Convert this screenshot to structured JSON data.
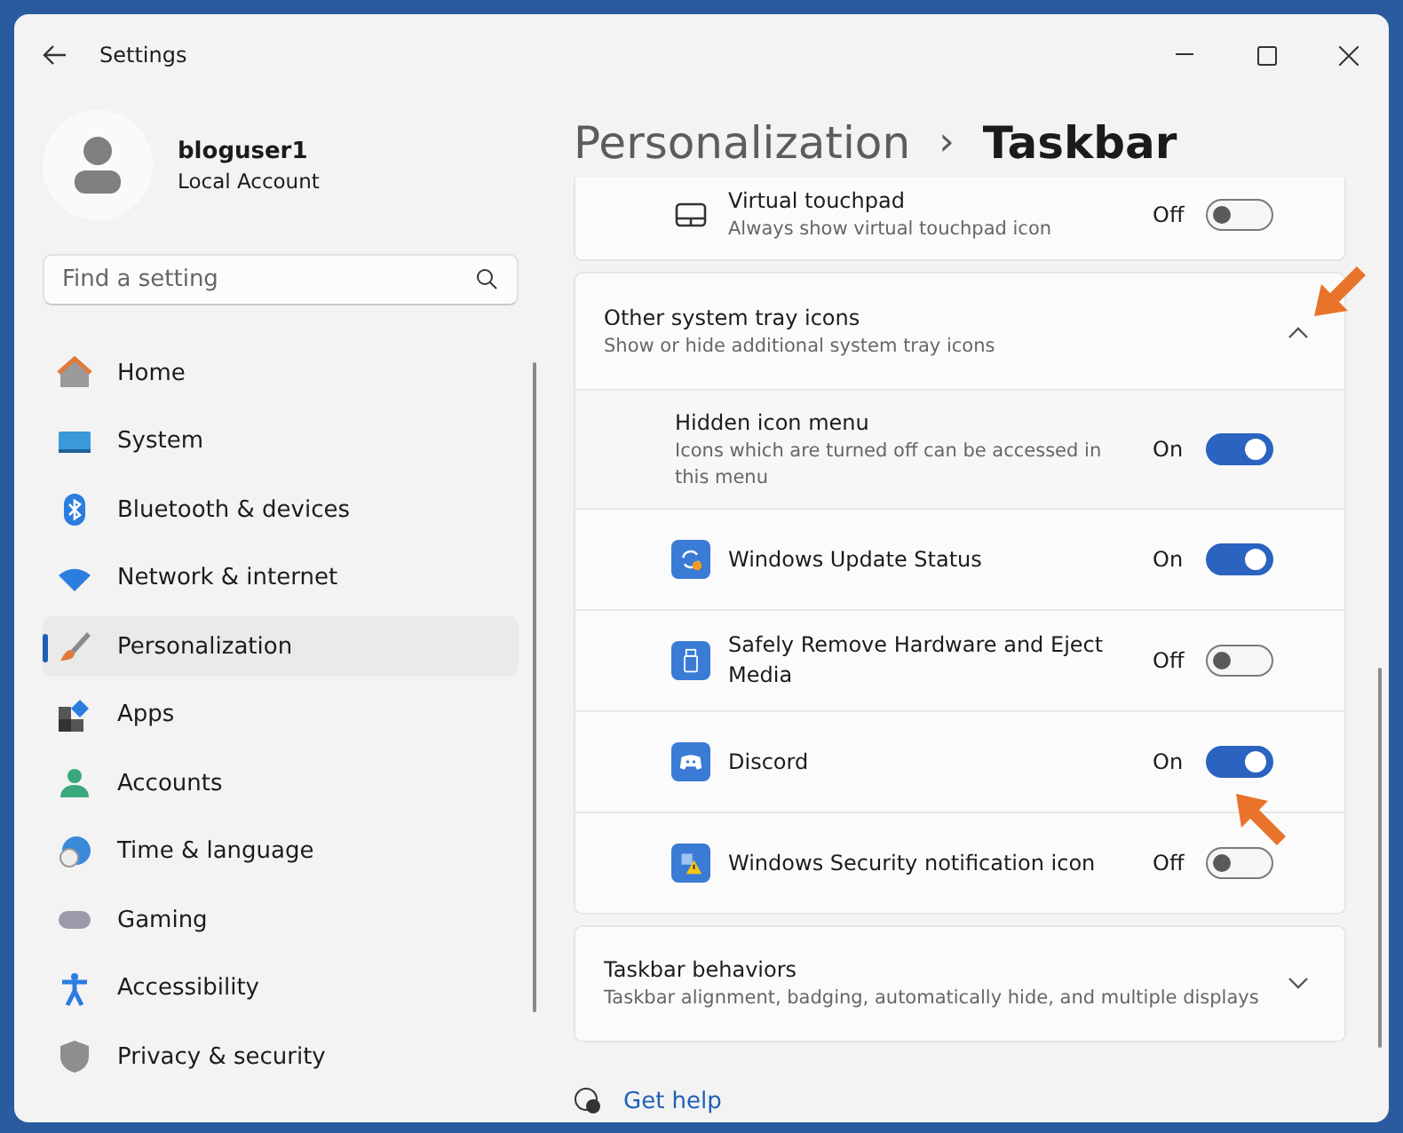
{
  "window": {
    "title": "Settings"
  },
  "profile": {
    "name": "bloguser1",
    "account": "Local Account"
  },
  "search": {
    "placeholder": "Find a setting"
  },
  "sidebar": {
    "items": [
      {
        "label": "Home",
        "selected": false
      },
      {
        "label": "System",
        "selected": false
      },
      {
        "label": "Bluetooth & devices",
        "selected": false
      },
      {
        "label": "Network & internet",
        "selected": false
      },
      {
        "label": "Personalization",
        "selected": true
      },
      {
        "label": "Apps",
        "selected": false
      },
      {
        "label": "Accounts",
        "selected": false
      },
      {
        "label": "Time & language",
        "selected": false
      },
      {
        "label": "Gaming",
        "selected": false
      },
      {
        "label": "Accessibility",
        "selected": false
      },
      {
        "label": "Privacy & security",
        "selected": false
      }
    ]
  },
  "breadcrumb": {
    "parent": "Personalization",
    "separator": "›",
    "current": "Taskbar"
  },
  "touchpad": {
    "title": "Virtual touchpad",
    "description": "Always show virtual touchpad icon",
    "state": "Off",
    "on": false
  },
  "tray": {
    "title": "Other system tray icons",
    "description": "Show or hide additional system tray icons",
    "expanded": true,
    "hidden_menu": {
      "title": "Hidden icon menu",
      "description": "Icons which are turned off can be accessed in this menu",
      "state": "On",
      "on": true
    },
    "items": [
      {
        "label": "Windows Update Status",
        "state": "On",
        "on": true
      },
      {
        "label": "Safely Remove Hardware and Eject Media",
        "state": "Off",
        "on": false
      },
      {
        "label": "Discord",
        "state": "On",
        "on": true
      },
      {
        "label": "Windows Security notification icon",
        "state": "Off",
        "on": false
      }
    ]
  },
  "behaviors": {
    "title": "Taskbar behaviors",
    "description": "Taskbar alignment, badging, automatically hide, and multiple displays",
    "expanded": false
  },
  "help": {
    "label": "Get help"
  }
}
